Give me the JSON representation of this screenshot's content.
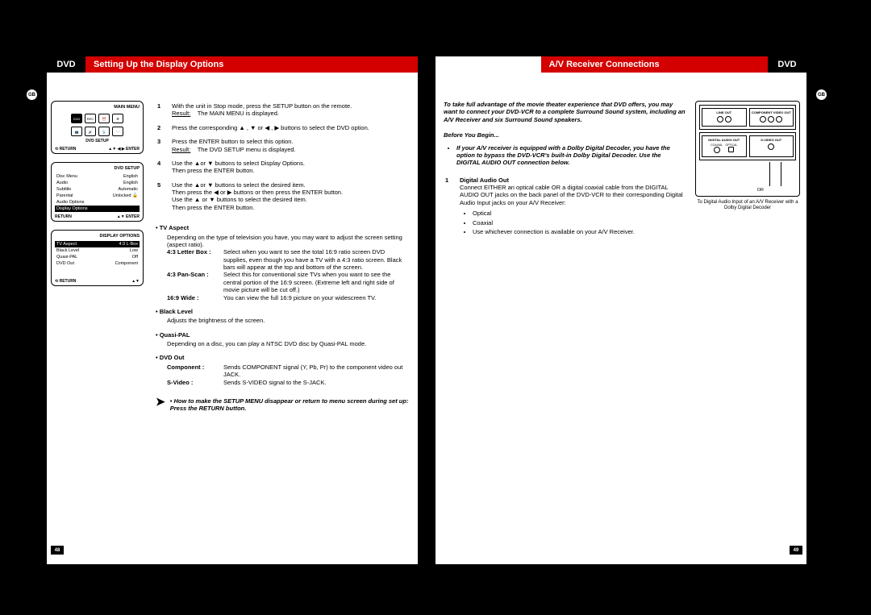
{
  "badge": "GB",
  "left": {
    "tag": "DVD",
    "title": "Setting Up the Display Options",
    "pagenum": "48",
    "mainmenu": {
      "title": "MAIN MENU",
      "caption": "DVD SETUP",
      "footer_left": "⟲ RETURN",
      "footer_right": "▲▼ ◀ ▶  ENTER"
    },
    "dvdsetup": {
      "title": "DVD SETUP",
      "rows": [
        {
          "k": "Disc Menu",
          "v": "English"
        },
        {
          "k": "Audio",
          "v": "English"
        },
        {
          "k": "Subtitle",
          "v": "Automatic"
        },
        {
          "k": "Parental",
          "v": "Unlocked 🔓"
        },
        {
          "k": "Audio Options",
          "v": ""
        },
        {
          "k": "Display Options",
          "v": ""
        }
      ],
      "footer_left": "RETURN",
      "footer_right": "▲▼   ENTER"
    },
    "dispopt": {
      "title": "DISPLAY OPTIONS",
      "rows": [
        {
          "k": "TV Aspect",
          "v": "4:3 L-Box"
        },
        {
          "k": "Black Level",
          "v": "Low"
        },
        {
          "k": "Quasi-PAL",
          "v": "Off"
        },
        {
          "k": "DVD Out",
          "v": "Component"
        }
      ],
      "footer_left": "⟲ RETURN",
      "footer_right": "▲▼"
    },
    "steps": [
      {
        "n": "1",
        "t": "With the unit in Stop mode, press the SETUP button on the remote.",
        "r": "Result:",
        "rt": "The MAIN MENU is displayed."
      },
      {
        "n": "2",
        "t": "Press the corresponding ▲ , ▼ or ◀ , ▶ buttons to select the DVD option."
      },
      {
        "n": "3",
        "t": "Press the ENTER button to select this option.",
        "r": "Result:",
        "rt": "The DVD SETUP  menu is displayed."
      },
      {
        "n": "4",
        "t": "Use the ▲or ▼ buttons to select Display Options.\nThen press the ENTER button."
      },
      {
        "n": "5",
        "t": "Use the ▲or ▼ buttons to select the desired item.\nThen press the ◀ or ▶ buttons or then press the ENTER button.\nUse the ▲ or ▼ buttons to select the desired item.\nThen press the ENTER button."
      }
    ],
    "tvaspect": {
      "head": "• TV Aspect",
      "body": "Depending on the type of television you have, you may want to adjust the screen setting (aspect ratio).",
      "opts": [
        {
          "k": "4:3 Letter Box :",
          "v": "Select when you want to see the total 16:9 ratio screen DVD supplies, even though you have a TV with a 4:3 ratio screen. Black bars will appear at the top and bottom of the screen."
        },
        {
          "k": "4:3 Pan-Scan :",
          "v": "Select this for conventional size TVs when you want to see the central portion of the 16:9 screen. (Extreme left and right side of movie picture will be cut off.)"
        },
        {
          "k": "16:9 Wide :",
          "v": "You can view the full 16:9 picture on your widescreen TV."
        }
      ]
    },
    "blacklevel": {
      "head": "• Black Level",
      "body": "Adjusts the brightness of the screen."
    },
    "quasipal": {
      "head": "• Quasi-PAL",
      "body": "Depending on a disc, you can play a NTSC DVD disc by Quasi-PAL mode."
    },
    "dvdout": {
      "head": "• DVD Out",
      "opts": [
        {
          "k": "Component :",
          "v": "Sends COMPONENT signal (Y, Pb, Pr) to the component video out JACK."
        },
        {
          "k": "S-Video :",
          "v": "Sends S-VIDEO signal to the S-JACK."
        }
      ]
    },
    "note": "How to make the SETUP MENU disappear or return to menu screen during set up: Press the RETURN button."
  },
  "right": {
    "tag": "DVD",
    "title": "A/V Receiver Connections",
    "pagenum": "49",
    "intro": "To take full advantage of the movie theater experience that DVD offers, you may want to connect your DVD-VCR to a complete Surround Sound system, including an A/V Receiver and six Surround Sound speakers.",
    "before": "Before You Begin...",
    "beforelist": "If your A/V receiver is equipped with a Dolby Digital Decoder, you have the option to bypass the DVD-VCR's built-in Dolby Digital Decoder. Use the DIGITAL AUDIO OUT connection below.",
    "step1": {
      "n": "1",
      "head": "Digital Audio Out",
      "body": "Connect EITHER an optical cable OR a digital coaxial cable from the DIGITAL AUDIO OUT jacks on the back panel of the DVD-VCR to their corresponding Digital Audio Input jacks on your A/V Receiver:",
      "opts": [
        "Optical",
        "Coaxial",
        "Use whichever connection is available on your A/V Receiver."
      ]
    },
    "diagram": {
      "lineout": "LINE OUT",
      "compout": "COMPONENT VIDEO OUT",
      "digital": "DIGITAL AUDIO OUT",
      "svideo": "S-VIDEO OUT",
      "coax": "COAXIAL",
      "opt": "OPTICAL",
      "or": "OR",
      "caption": "To Digital Audio Input of an A/V Receiver with a Dolby Digital Decoder"
    }
  }
}
